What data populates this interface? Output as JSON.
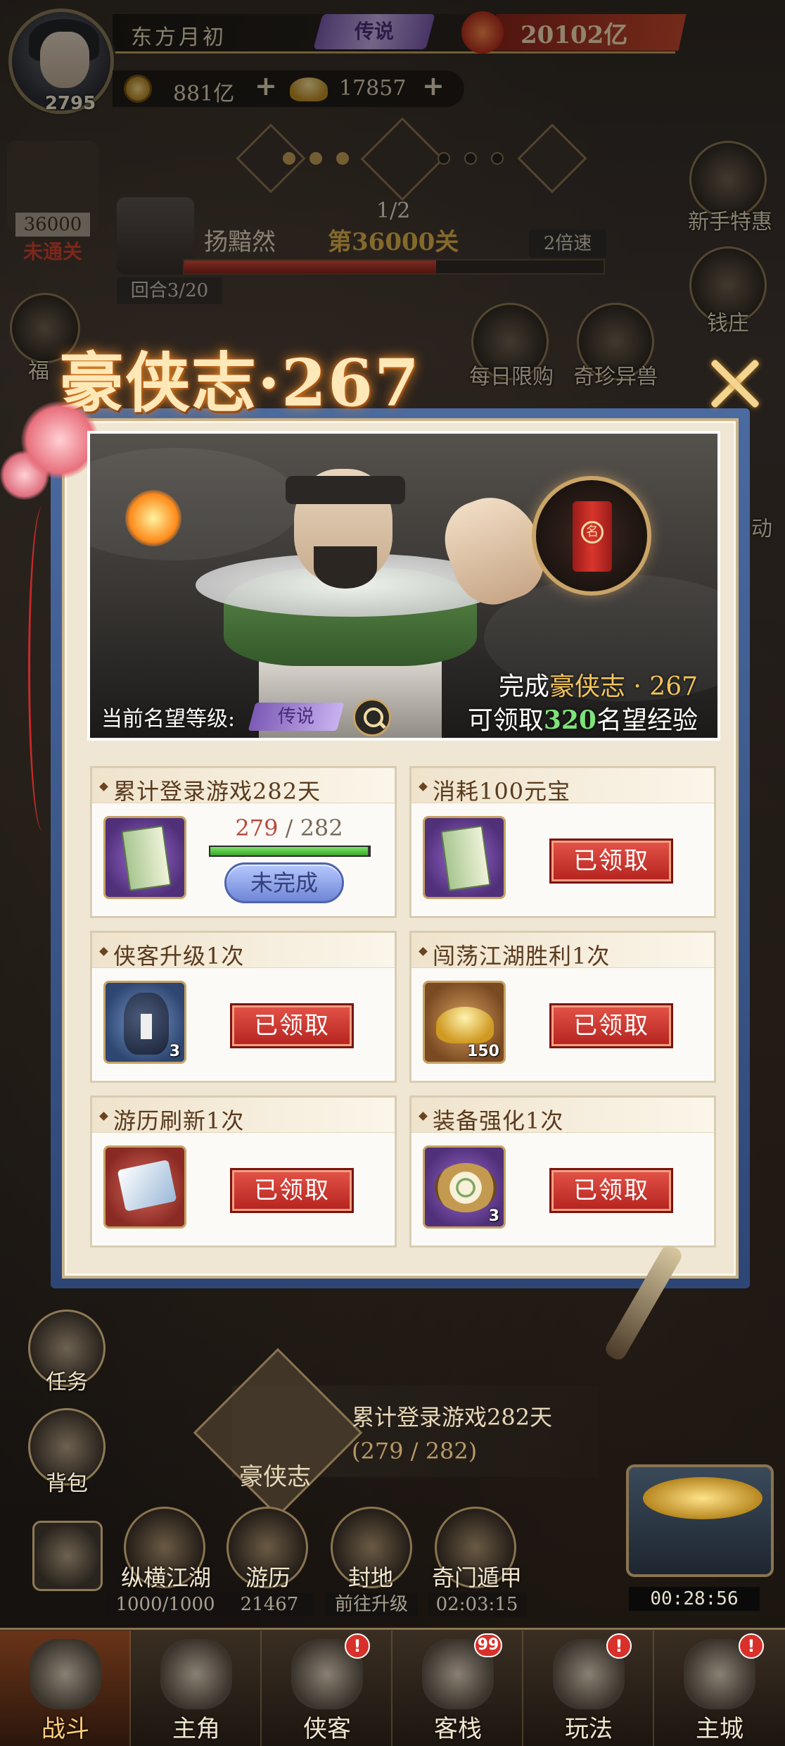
{
  "player": {
    "name": "东方月初",
    "level": "2795",
    "rank": "传说",
    "power": "20102亿",
    "coins": "881亿",
    "ingots": "17857",
    "plus": "+"
  },
  "stage": {
    "pass_number": "36000",
    "pass_status": "未通关",
    "count": "1/2",
    "level": "第36000关",
    "enemy": "扬黯然",
    "speed": "2倍速",
    "round": "回合3/20",
    "hp_fraction": 0.6
  },
  "side_buttons": {
    "newbie": "新手特惠",
    "bank": "钱庄",
    "daily": "每日限购",
    "beast": "奇珍异兽",
    "fortune": "福",
    "activity": "动",
    "task": "任务",
    "bag": "背包"
  },
  "modal": {
    "title": "豪侠志·267",
    "complete_prefix": "完成",
    "complete_name": "豪侠志 · 267",
    "reward_prefix": "可领取",
    "reward_amount": "320",
    "reward_suffix": "名望经验",
    "fame_label": "当前名望等级:",
    "fame_rank": "传说",
    "seal_char": "名",
    "tasks": [
      {
        "title": "累计登录游戏282天",
        "qty": "",
        "progress_current": "279",
        "progress_sep": " / ",
        "progress_max": "282",
        "progress_fraction": 0.989,
        "button": "未完成"
      },
      {
        "title": "消耗100元宝",
        "qty": "",
        "button": "已领取"
      },
      {
        "title": "侠客升级1次",
        "qty": "3",
        "button": "已领取"
      },
      {
        "title": "闯荡江湖胜利1次",
        "qty": "150",
        "button": "已领取"
      },
      {
        "title": "游历刷新1次",
        "qty": "",
        "button": "已领取"
      },
      {
        "title": "装备强化1次",
        "qty": "3",
        "button": "已领取"
      }
    ]
  },
  "quest": {
    "name": "累计登录游戏282天",
    "progress": "(279 / 282)",
    "label": "豪侠志"
  },
  "features": [
    {
      "label": "纵横江湖",
      "value": "1000/1000"
    },
    {
      "label": "游历",
      "value": "21467"
    },
    {
      "label": "封地",
      "value": "前往升级"
    },
    {
      "label": "奇门遁甲",
      "value": "02:03:15"
    }
  ],
  "chest_timer": "00:28:56",
  "nav": [
    {
      "label": "战斗",
      "badge": ""
    },
    {
      "label": "主角",
      "badge": ""
    },
    {
      "label": "侠客",
      "badge": "!"
    },
    {
      "label": "客栈",
      "badge": "99"
    },
    {
      "label": "玩法",
      "badge": "!"
    },
    {
      "label": "主城",
      "badge": "!"
    }
  ]
}
